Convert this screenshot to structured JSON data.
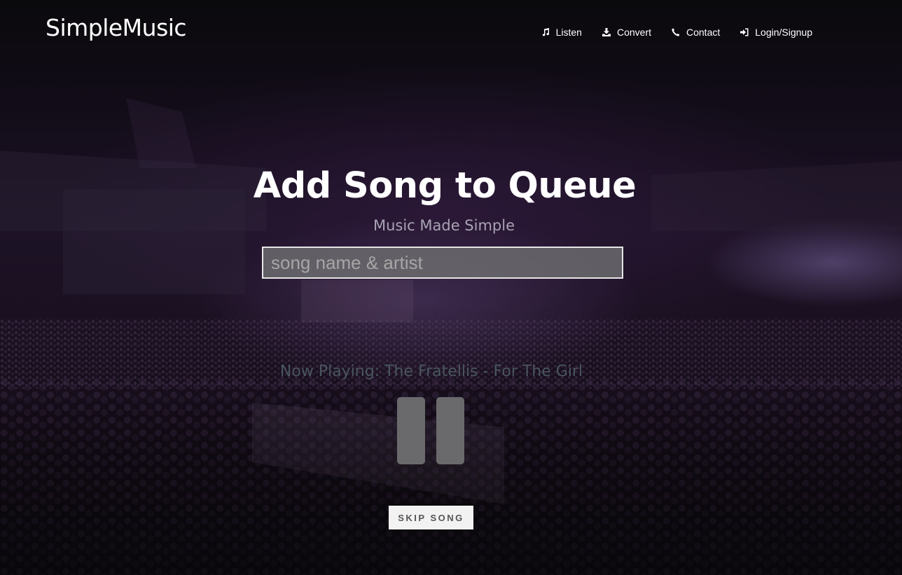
{
  "navbar": {
    "brand": "SimpleMusic",
    "links": [
      {
        "label": "Listen",
        "icon": "music-note-icon"
      },
      {
        "label": "Convert",
        "icon": "download-icon"
      },
      {
        "label": "Contact",
        "icon": "phone-icon"
      },
      {
        "label": "Login/Signup",
        "icon": "login-icon"
      }
    ]
  },
  "hero": {
    "title": "Add Song to Queue",
    "subtitle": "Music Made Simple",
    "search_placeholder": "song name & artist",
    "search_value": ""
  },
  "player": {
    "now_playing": "Now Playing: The Fratellis - For The Girl",
    "state_icon": "pause-icon",
    "skip_label": "SKIP SONG"
  },
  "colors": {
    "text_primary": "#ffffff",
    "subtitle": "#a9a2b3",
    "now_playing": "#4a5560",
    "pause_bars": "#6a6a6c",
    "skip_bg": "#f2f2f2",
    "skip_text": "#555555"
  }
}
